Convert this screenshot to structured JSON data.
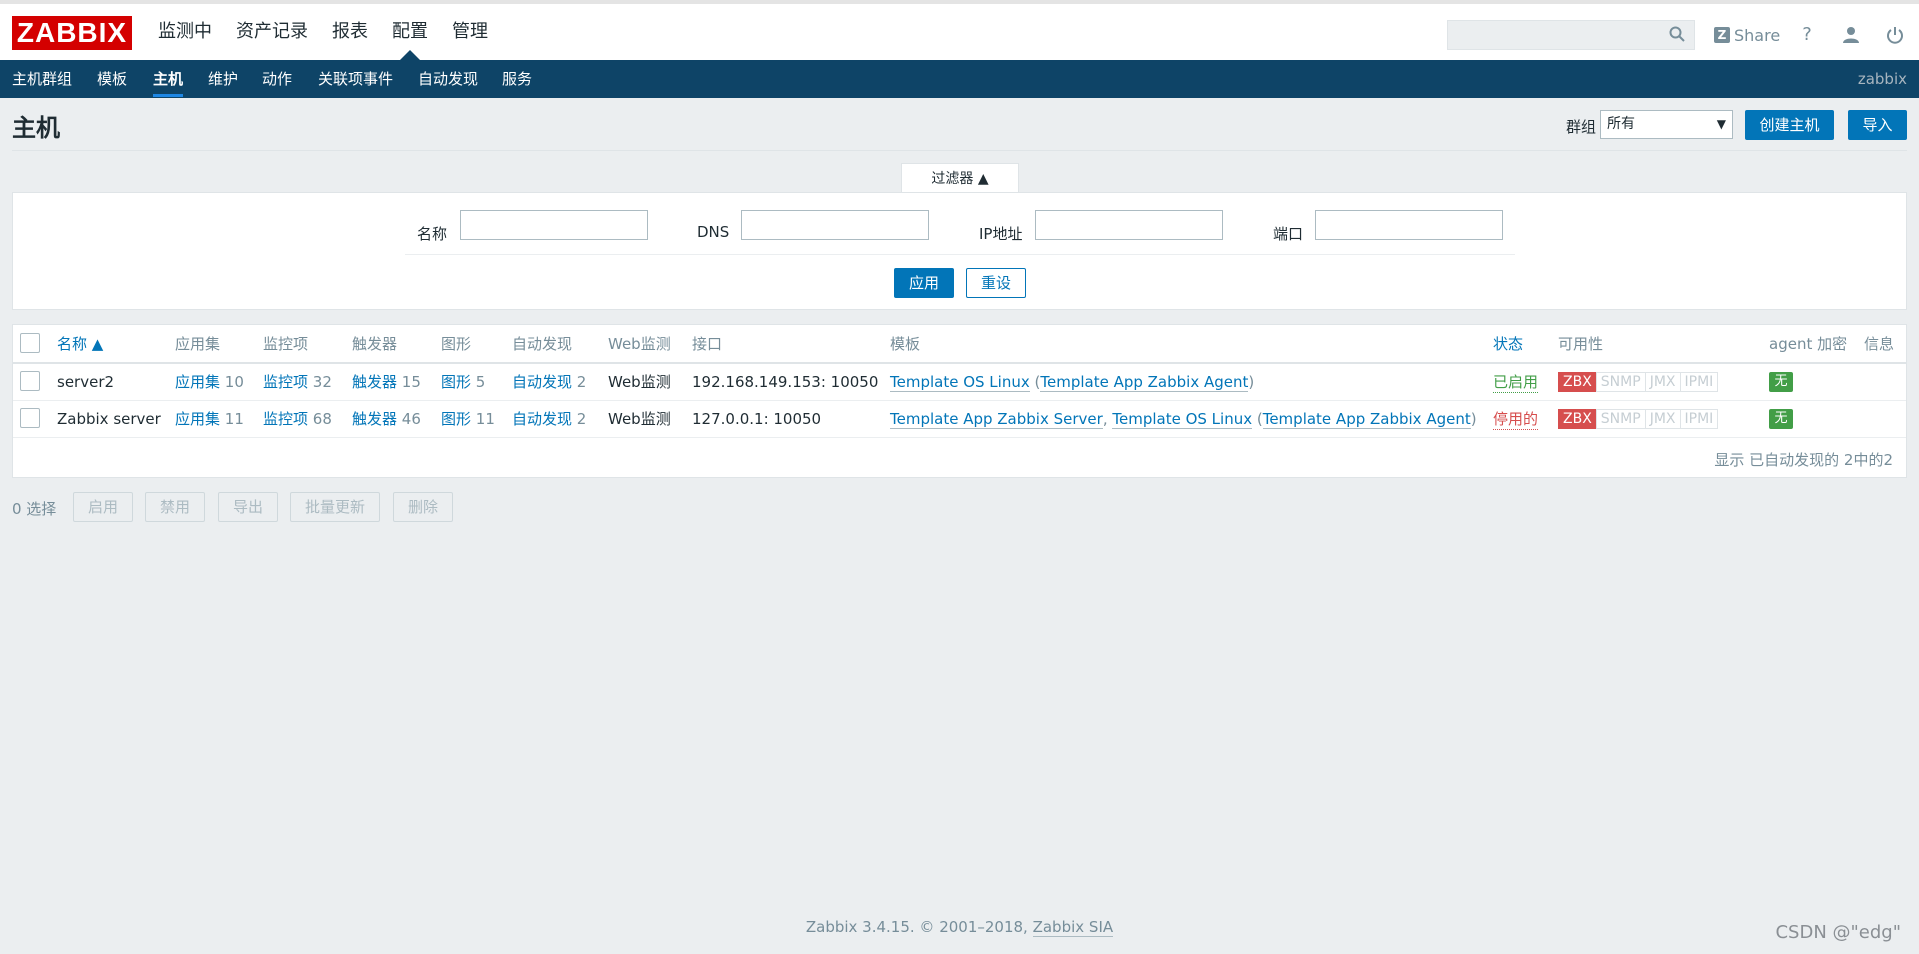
{
  "header": {
    "logo": "ZABBIX",
    "main_menu": [
      "监测中",
      "资产记录",
      "报表",
      "配置",
      "管理"
    ],
    "active_menu": "配置",
    "share_label": "Share",
    "share_badge": "Z",
    "help_icon": "?",
    "user_icon": "user-icon",
    "logout_icon": "power-icon"
  },
  "subnav": {
    "items": [
      "主机群组",
      "模板",
      "主机",
      "维护",
      "动作",
      "关联项事件",
      "自动发现",
      "服务"
    ],
    "active": "主机",
    "server_name": "zabbix"
  },
  "page": {
    "title": "主机",
    "group_label": "群组",
    "group_value": "所有",
    "create_button": "创建主机",
    "import_button": "导入"
  },
  "filter": {
    "tab_label": "过滤器 ▲",
    "fields": [
      {
        "label": "名称",
        "value": ""
      },
      {
        "label": "DNS",
        "value": ""
      },
      {
        "label": "IP地址",
        "value": ""
      },
      {
        "label": "端口",
        "value": ""
      }
    ],
    "apply_button": "应用",
    "reset_button": "重设"
  },
  "table": {
    "columns": [
      "名称 ▲",
      "应用集",
      "监控项",
      "触发器",
      "图形",
      "自动发现",
      "Web监测",
      "接口",
      "模板",
      "状态",
      "可用性",
      "agent 加密",
      "信息"
    ],
    "rows": [
      {
        "name": "server2",
        "apps_label": "应用集",
        "apps_count": "10",
        "items_label": "监控项",
        "items_count": "32",
        "triggers_label": "触发器",
        "triggers_count": "15",
        "graphs_label": "图形",
        "graphs_count": "5",
        "discovery_label": "自动发现",
        "discovery_count": "2",
        "web_label": "Web监测",
        "interface": "192.168.149.153: 10050",
        "templates": {
          "t1": "Template OS Linux",
          "p_open": " (",
          "t2": "Template App Zabbix Agent",
          "p_close": ")"
        },
        "status": "已启用",
        "availability": [
          "ZBX",
          "SNMP",
          "JMX",
          "IPMI"
        ],
        "encryption": "无"
      },
      {
        "name": "Zabbix server",
        "apps_label": "应用集",
        "apps_count": "11",
        "items_label": "监控项",
        "items_count": "68",
        "triggers_label": "触发器",
        "triggers_count": "46",
        "graphs_label": "图形",
        "graphs_count": "11",
        "discovery_label": "自动发现",
        "discovery_count": "2",
        "web_label": "Web监测",
        "interface": "127.0.0.1: 10050",
        "templates": {
          "t1": "Template App Zabbix Server",
          "sep": ", ",
          "t2": "Template OS Linux",
          "p_open": " (",
          "t3": "Template App Zabbix Agent",
          "p_close": ")"
        },
        "status": "停用的",
        "availability": [
          "ZBX",
          "SNMP",
          "JMX",
          "IPMI"
        ],
        "encryption": "无"
      }
    ],
    "summary": "显示 已自动发现的 2中的2"
  },
  "actions": {
    "selected": "0 选择",
    "buttons": [
      "启用",
      "禁用",
      "导出",
      "批量更新",
      "删除"
    ]
  },
  "footer": {
    "text": "Zabbix 3.4.15. © 2001–2018, ",
    "brand": "Zabbix SIA",
    "watermark": "CSDN @\"edg\""
  },
  "colors": {
    "brand_red": "#d40000",
    "nav_blue": "#0e4467",
    "link_blue": "#0275b8",
    "ok_green": "#429e47",
    "error_red": "#d64e4e"
  }
}
